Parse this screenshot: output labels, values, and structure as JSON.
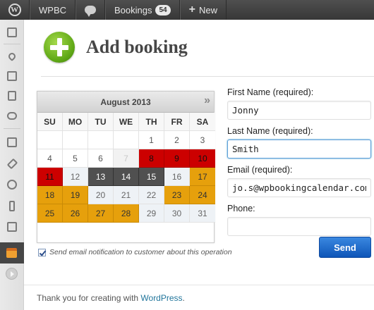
{
  "adminbar": {
    "logo_icon": "wordpress-logo-icon",
    "site_name": "WPBC",
    "comments_icon": "comment-bubble-icon",
    "bookings_label": "Bookings",
    "bookings_count": "54",
    "new_label": "New"
  },
  "sidebar": {
    "items": [
      "dashboard-icon",
      "pin-icon",
      "media-icon",
      "pages-icon",
      "comments-icon",
      "appearance-icon",
      "plugins-icon",
      "users-icon",
      "tools-icon",
      "settings-icon",
      "booking-calendar-icon",
      "collapse-menu-icon"
    ],
    "current": "booking-calendar-icon"
  },
  "page": {
    "title": "Add booking",
    "title_icon": "add-booking-plus-icon"
  },
  "calendar": {
    "month_label": "August 2013",
    "next_icon": "next-month-icon",
    "weekdays": [
      "SU",
      "MO",
      "TU",
      "WE",
      "TH",
      "FR",
      "SA"
    ],
    "days": [
      {
        "d": "",
        "s": "blank"
      },
      {
        "d": "",
        "s": "blank"
      },
      {
        "d": "",
        "s": "blank"
      },
      {
        "d": "",
        "s": "blank"
      },
      {
        "d": "1",
        "s": "normal"
      },
      {
        "d": "2",
        "s": "normal"
      },
      {
        "d": "3",
        "s": "normal"
      },
      {
        "d": "4",
        "s": "normal"
      },
      {
        "d": "5",
        "s": "normal"
      },
      {
        "d": "6",
        "s": "normal"
      },
      {
        "d": "7",
        "s": "past"
      },
      {
        "d": "8",
        "s": "red"
      },
      {
        "d": "9",
        "s": "red"
      },
      {
        "d": "10",
        "s": "red"
      },
      {
        "d": "11",
        "s": "red"
      },
      {
        "d": "12",
        "s": "avail"
      },
      {
        "d": "13",
        "s": "dark"
      },
      {
        "d": "14",
        "s": "dark"
      },
      {
        "d": "15",
        "s": "dark"
      },
      {
        "d": "16",
        "s": "avail"
      },
      {
        "d": "17",
        "s": "orange"
      },
      {
        "d": "18",
        "s": "orange"
      },
      {
        "d": "19",
        "s": "orange"
      },
      {
        "d": "20",
        "s": "avail"
      },
      {
        "d": "21",
        "s": "avail"
      },
      {
        "d": "22",
        "s": "avail"
      },
      {
        "d": "23",
        "s": "orange"
      },
      {
        "d": "24",
        "s": "orange"
      },
      {
        "d": "25",
        "s": "orange"
      },
      {
        "d": "26",
        "s": "orange"
      },
      {
        "d": "27",
        "s": "orange"
      },
      {
        "d": "28",
        "s": "orange"
      },
      {
        "d": "29",
        "s": "avail"
      },
      {
        "d": "30",
        "s": "avail"
      },
      {
        "d": "31",
        "s": "avail"
      }
    ],
    "colors": {
      "booked": "#cc0000",
      "selected": "#505050",
      "pending": "#e6a00c"
    }
  },
  "notify": {
    "checked": true,
    "label": "Send email notification to customer about this operation"
  },
  "form": {
    "first_name_label": "First Name (required):",
    "first_name_value": "Jonny",
    "last_name_label": "Last Name (required):",
    "last_name_value": "Smith",
    "email_label": "Email (required):",
    "email_value": "jo.s@wpbookingcalendar.com",
    "phone_label": "Phone:",
    "phone_value": "",
    "send_label": "Send"
  },
  "footer": {
    "text_before": "Thank you for creating with ",
    "link": "WordPress",
    "text_after": "."
  }
}
